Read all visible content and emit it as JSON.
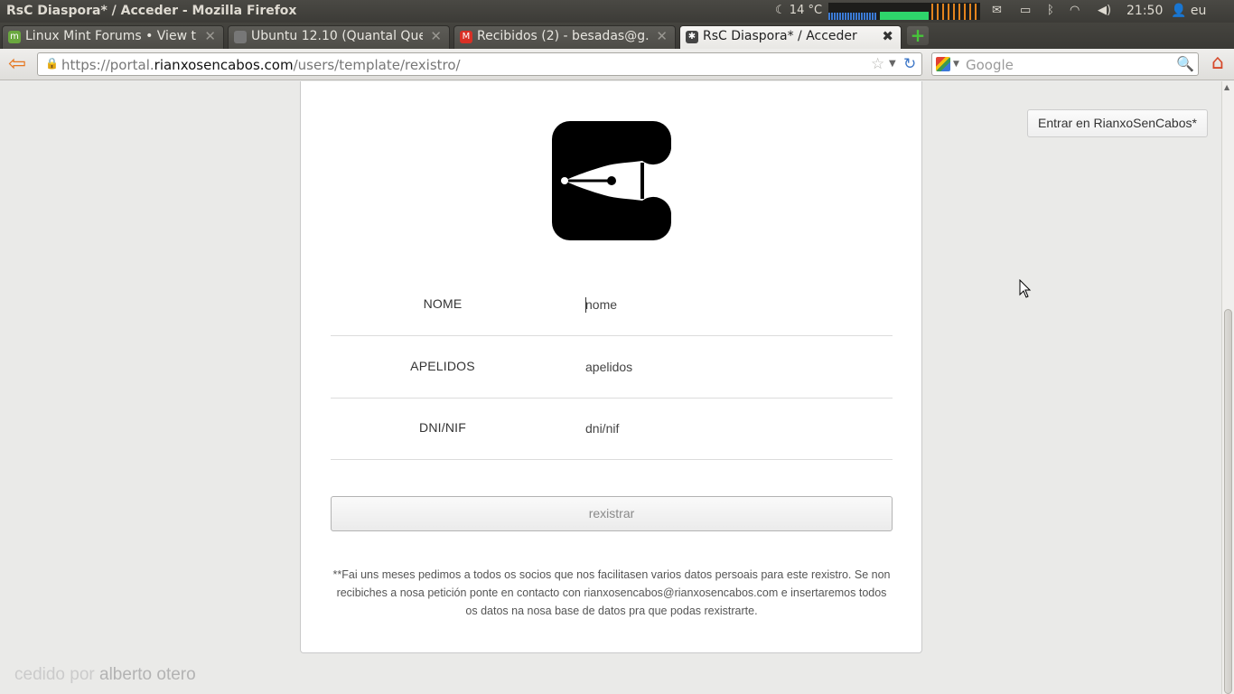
{
  "os_panel": {
    "window_title": "RsC Diaspora* / Acceder - Mozilla Firefox",
    "weather": "14 °C",
    "clock": "21:50",
    "user": "eu"
  },
  "tabs": [
    {
      "label": "Linux Mint Forums • View t...",
      "favicon_color": "#6aa83f"
    },
    {
      "label": "Ubuntu 12.10 (Quantal Quet...",
      "favicon_color": "#777777"
    },
    {
      "label": "Recibidos (2) - besadas@g...",
      "favicon_color": "#d93025"
    },
    {
      "label": "RsC Diaspora* / Acceder",
      "favicon_color": "#444444"
    }
  ],
  "navbar": {
    "url_prefix": "https://portal.",
    "url_domain": "rianxosencabos.com",
    "url_path": "/users/template/rexistro/",
    "search_placeholder": "Google"
  },
  "page": {
    "enter_button": "Entrar en RianxoSenCabos*",
    "fields": [
      {
        "label": "NOME",
        "placeholder": "nome"
      },
      {
        "label": "APELIDOS",
        "placeholder": "apelidos"
      },
      {
        "label": "DNI/NIF",
        "placeholder": "dni/nif"
      }
    ],
    "submit_label": "rexistrar",
    "note": "**Fai uns meses pedimos a todos os socios que nos facilitasen varios datos persoais para este rexistro. Se non recibiches a nosa petición ponte en contacto con rianxosencabos@rianxosencabos.com e insertaremos todos os datos na nosa base de datos pra que podas rexistrarte.",
    "credit_prefix": "cedido por ",
    "credit_name": "alberto otero"
  },
  "colors": {
    "accent_orange": "#e5761f",
    "card_bg": "#ffffff",
    "page_bg": "#eaeae8"
  }
}
